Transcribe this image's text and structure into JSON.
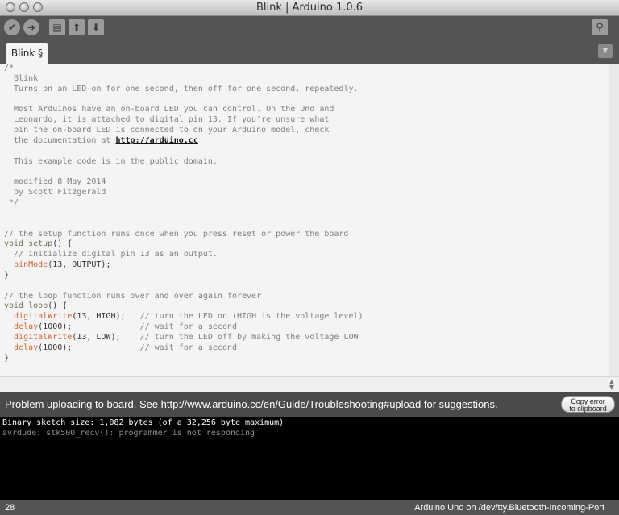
{
  "window": {
    "title": "Blink | Arduino 1.0.6"
  },
  "toolbar": {
    "buttons": [
      {
        "name": "verify",
        "icon": "check-icon",
        "glyph": "✔"
      },
      {
        "name": "upload",
        "icon": "arrow-right-icon",
        "glyph": "➜"
      },
      {
        "name": "new",
        "icon": "document-icon",
        "glyph": "▤"
      },
      {
        "name": "open",
        "icon": "arrow-up-icon",
        "glyph": "⬆"
      },
      {
        "name": "save",
        "icon": "arrow-down-icon",
        "glyph": "⬇"
      },
      {
        "name": "serial-monitor",
        "icon": "magnifier-icon",
        "glyph": "⚲"
      }
    ]
  },
  "tabs": [
    {
      "label": "Blink §"
    }
  ],
  "tab_menu_glyph": "▼",
  "editor": {
    "lines": [
      "/*",
      "  Blink",
      "  Turns on an LED on for one second, then off for one second, repeatedly.",
      "",
      "  Most Arduinos have an on-board LED you can control. On the Uno and",
      "  Leonardo, it is attached to digital pin 13. If you're unsure what",
      "  pin the on-board LED is connected to on your Arduino model, check",
      "  the documentation at ",
      "",
      "  This example code is in the public domain.",
      "",
      "  modified 8 May 2014",
      "  by Scott Fitzgerald",
      " */",
      "",
      "",
      "// the setup function runs once when you press reset or power the board",
      "void setup() {",
      "  // initialize digital pin 13 as an output.",
      "  pinMode(13, OUTPUT);",
      "}",
      "",
      "// the loop function runs over and over again forever",
      "void loop() {",
      "  digitalWrite(13, HIGH);   // turn the LED on (HIGH is the voltage level)",
      "  delay(1000);              // wait for a second",
      "  digitalWrite(13, LOW);    // turn the LED off by making the voltage LOW",
      "  delay(1000);              // wait for a second",
      "}"
    ],
    "link": "http://arduino.cc"
  },
  "status": {
    "message": "Problem uploading to board.  See http://www.arduino.cc/en/Guide/Troubleshooting#upload for suggestions.",
    "copy_button": [
      "Copy error",
      "to clipboard"
    ]
  },
  "console": {
    "lines": [
      {
        "text": "Binary sketch size: 1,082 bytes (of a 32,256 byte maximum)",
        "color": "#ffffff"
      },
      {
        "text": "avrdude: stk500_recv(): programmer is not responding",
        "color": "#8c8c8c"
      }
    ]
  },
  "footer": {
    "line_number": "28",
    "board": "Arduino Uno on /dev/tty.Bluetooth-Incoming-Port"
  },
  "colors": {
    "toolbar_bg": "#545454",
    "editor_bg": "#f4f4f4",
    "console_bg": "#000000",
    "comment": "#808080",
    "keyword": "#6f6f4f",
    "function": "#cc6633"
  }
}
